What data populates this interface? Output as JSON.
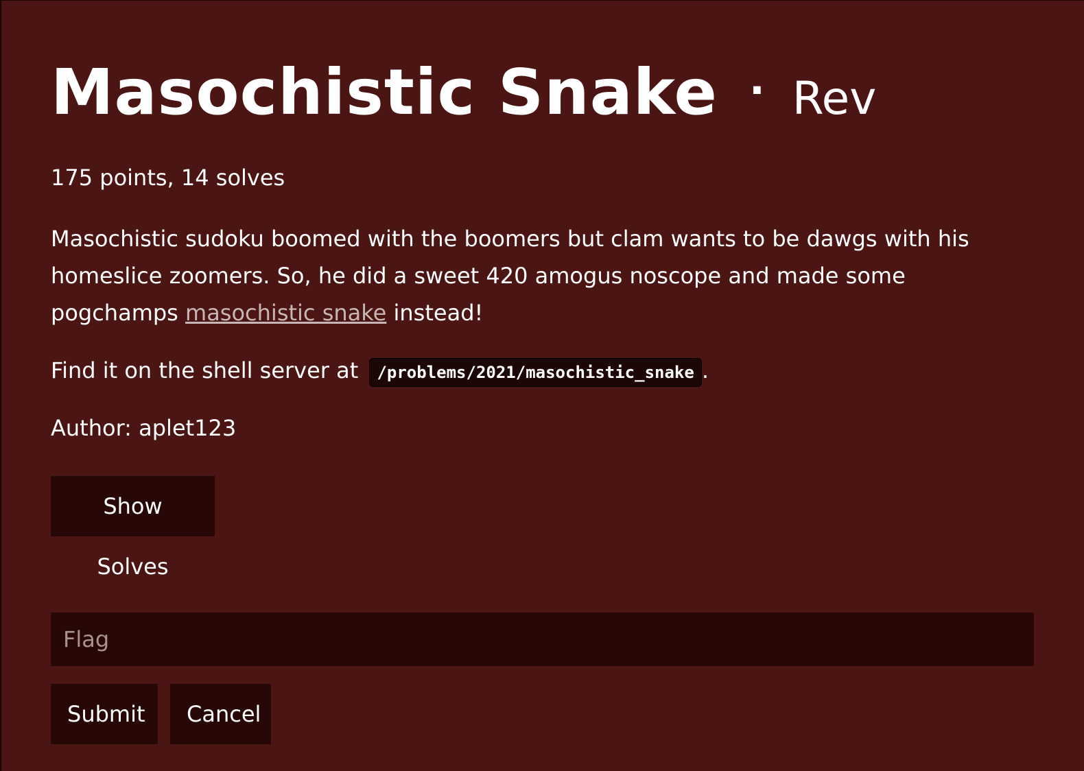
{
  "challenge": {
    "title": "Masochistic Snake",
    "separator": "·",
    "category": "Rev",
    "meta": "175 points, 14 solves",
    "description_before_link": "Masochistic sudoku boomed with the boomers but clam wants to be dawgs with his homeslice zoomers. So, he did a sweet 420 amogus noscope and made some pogchamps ",
    "description_link": "masochistic snake",
    "description_after_link": " instead!",
    "shell_prefix": "Find it on the shell server at ",
    "shell_path": "/problems/2021/masochistic_snake",
    "shell_suffix": ".",
    "author": "Author: aplet123"
  },
  "actions": {
    "show_solves_label": "Show Solves",
    "flag_placeholder": "Flag",
    "submit_label": "Submit",
    "cancel_label": "Cancel"
  },
  "colors": {
    "background": "#4a1512",
    "button_bg": "#270807",
    "link": "#c8b6b4"
  }
}
